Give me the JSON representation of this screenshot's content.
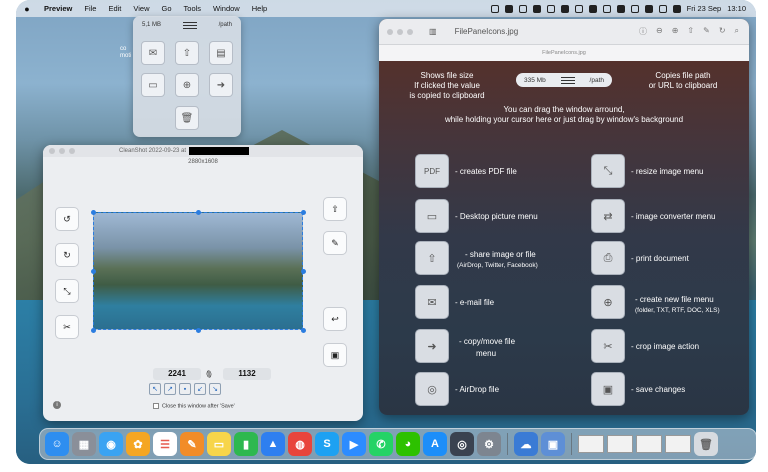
{
  "menubar": {
    "app": "Preview",
    "items": [
      "File",
      "Edit",
      "View",
      "Go",
      "Tools",
      "Window",
      "Help"
    ],
    "date": "Fri 23 Sep",
    "time": "13:10"
  },
  "filepane_mini": {
    "size": "5,1 MB",
    "path": "/path"
  },
  "desktop_icon": {
    "label_line1": "co",
    "label_line2": "moti"
  },
  "cleanshot": {
    "title": "CleanShot 2022-09-23 at",
    "dimensions": "2880x1608",
    "width": "2241",
    "height": "1132",
    "close_note": "Close this window after 'Save'"
  },
  "preview": {
    "title": "FilePaneIcons.jpg",
    "subtitle": "FilePaneIcons.jpg",
    "pill_size": "335 Mb",
    "pill_path": "/path",
    "ann_left": [
      "Shows file size",
      "If clicked the value",
      "is copied to clipboard"
    ],
    "ann_right": [
      "Copies file path",
      "or URL to clipboard"
    ],
    "ann_drag": [
      "You can drag the window arround,",
      "while holding your cursor here or just drag by window's background"
    ],
    "ann_drag_first": "You can drag the window arround,",
    "ann_drag_second": "while holding your cursor here or just drag by window's background",
    "left_items": [
      {
        "icon": "pdf-icon",
        "glyph": "PDF",
        "label": "- creates PDF file"
      },
      {
        "icon": "desktop-picture-icon",
        "glyph": "🖼",
        "label": "- Desktop picture menu"
      },
      {
        "icon": "share-icon",
        "glyph": "⇧",
        "label": "- share image or file",
        "sub": "(AirDrop, Twitter, Facebook)"
      },
      {
        "icon": "email-icon",
        "glyph": "✉",
        "label": "- e-mail file"
      },
      {
        "icon": "copy-move-icon",
        "glyph": "➜",
        "label": "- copy/move file",
        "label2": "menu"
      },
      {
        "icon": "airdrop-icon",
        "glyph": "◎",
        "label": "- AirDrop file"
      }
    ],
    "right_items": [
      {
        "icon": "resize-image-icon",
        "glyph": "⤡",
        "label": "- resize image menu"
      },
      {
        "icon": "image-converter-icon",
        "glyph": "⇄",
        "label": "- image converter menu"
      },
      {
        "icon": "print-icon",
        "glyph": "⎙",
        "label": "- print document"
      },
      {
        "icon": "new-file-icon",
        "glyph": "⊕",
        "label": "- create new file menu",
        "sub": "(folder, TXT, RTF, DOC, XLS)"
      },
      {
        "icon": "crop-icon",
        "glyph": "✂",
        "label": "- crop image action"
      },
      {
        "icon": "save-icon",
        "glyph": "💾",
        "label": "- save changes"
      }
    ]
  },
  "dock": {
    "apps": [
      {
        "name": "finder-icon",
        "glyph": "☺",
        "color": "#2e8ef0"
      },
      {
        "name": "launchpad-icon",
        "glyph": "▦",
        "color": "#8a8f99"
      },
      {
        "name": "safari-icon",
        "glyph": "◉",
        "color": "#3aa3f2"
      },
      {
        "name": "photos-icon",
        "glyph": "✿",
        "color": "#f5a623"
      },
      {
        "name": "reminders-icon",
        "glyph": "☰",
        "color": "#ffffff"
      },
      {
        "name": "pages-icon",
        "glyph": "✎",
        "color": "#f28c28"
      },
      {
        "name": "notes-icon",
        "glyph": "▭",
        "color": "#f7d54a"
      },
      {
        "name": "numbers-icon",
        "glyph": "▮",
        "color": "#2eb84f"
      },
      {
        "name": "keynote-icon",
        "glyph": "▲",
        "color": "#2e7ff0"
      },
      {
        "name": "chrome-icon",
        "glyph": "◍",
        "color": "#e8453c"
      },
      {
        "name": "skype-icon",
        "glyph": "S",
        "color": "#1da1f2"
      },
      {
        "name": "zoom-icon",
        "glyph": "▶",
        "color": "#2d8cff"
      },
      {
        "name": "whatsapp-icon",
        "glyph": "✆",
        "color": "#25d366"
      },
      {
        "name": "wechat-icon",
        "glyph": "◕",
        "color": "#2dc100"
      },
      {
        "name": "appstore-icon",
        "glyph": "A",
        "color": "#1c8ef9"
      },
      {
        "name": "quicktime-icon",
        "glyph": "◎",
        "color": "#3a4250"
      },
      {
        "name": "system-preferences-icon",
        "glyph": "⚙",
        "color": "#7d8590"
      },
      {
        "name": "filepane-icon",
        "glyph": "☁",
        "color": "#3a7bd5"
      },
      {
        "name": "preview-icon",
        "glyph": "▣",
        "color": "#5e8fd6"
      }
    ]
  }
}
